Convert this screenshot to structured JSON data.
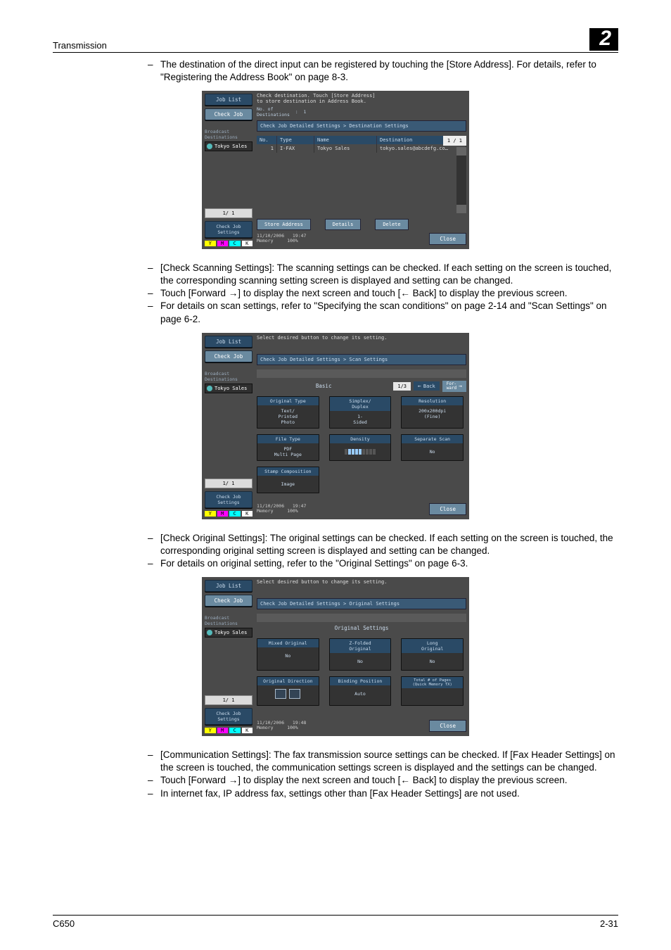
{
  "header": {
    "section": "Transmission",
    "chapter": "2"
  },
  "footer": {
    "left": "C650",
    "right": "2-31"
  },
  "para1": "The destination of the direct input can be registered by touching the [Store Address]. For details, refer to \"Registering the Address Book\" on page 8-3.",
  "para2a": "[Check Scanning Settings]: The scanning settings can be checked. If each setting on the screen is touched, the corresponding scanning setting screen is displayed and setting can be changed.",
  "para2b": "Touch [Forward →] to display the next screen and touch [← Back] to display the previous screen.",
  "para2c": "For details on scan settings, refer to \"Specifying the scan conditions\" on page 2-14 and \"Scan Settings\" on page 6-2.",
  "para3a": "[Check Original Settings]: The original settings can be checked. If each setting on the screen is touched, the corresponding original setting screen is displayed and setting can be changed.",
  "para3b": "For details on original setting, refer to the \"Original Settings\" on page 6-3.",
  "para4a": "[Communication Settings]: The fax transmission source settings can be checked. If [Fax Header Settings] on the screen is touched, the communication settings screen is displayed and the settings can be changed.",
  "para4b": "Touch [Forward →] to display the next screen and touch [← Back] to display the previous screen.",
  "para4c": "In internet fax, IP address fax, settings other than [Fax Header Settings] are not used.",
  "common": {
    "job_list": "Job List",
    "check_job": "Check Job",
    "broadcast": "Broadcast\nDestinations",
    "tokyo": "Tokyo Sales",
    "counter": "1/   1",
    "check_settings": "Check Job\nSettings",
    "close": "Close",
    "memory": "Memory",
    "mem_pct": "100%"
  },
  "s1": {
    "msg": "Check destination. Touch [Store Address]\nto store destination in Address Book.",
    "numdest_label": "No. of\nDestinations",
    "numdest_val": "1",
    "breadcrumb": "Check Job Detailed Settings > Destination Settings",
    "th": {
      "no": "No.",
      "type": "Type",
      "name": "Name",
      "dest": "Destination"
    },
    "row": {
      "no": "1",
      "type": "I-FAX",
      "name": "Tokyo Sales",
      "dest": "tokyo.sales@abcdefg.co…"
    },
    "page": "1 / 1",
    "store": "Store Address",
    "details": "Details",
    "delete": "Delete",
    "date": "11/10/2006",
    "time": "19:47"
  },
  "s2": {
    "msg": "Select desired button to change its setting.",
    "breadcrumb": "Check Job Detailed Settings > Scan Settings",
    "basic": "Basic",
    "page": "1/3",
    "back": "Back",
    "forward": "For-\nward",
    "tiles": {
      "original_type": {
        "h": "Original Type",
        "b": "Text/\nPrinted\nPhoto"
      },
      "duplex": {
        "h": "Simplex/\nDuplex",
        "b": "1-\nSided"
      },
      "resolution": {
        "h": "Resolution",
        "b": "200x200dpi\n(Fine)"
      },
      "file_type": {
        "h": "File Type",
        "b": "PDF\nMulti Page"
      },
      "density": {
        "h": "Density"
      },
      "separate": {
        "h": "Separate Scan",
        "b": "No"
      },
      "stamp": {
        "h": "Stamp Composition",
        "b": "Image"
      }
    },
    "date": "11/10/2006",
    "time": "19:47"
  },
  "s3": {
    "msg": "Select desired button to change its setting.",
    "breadcrumb": "Check Job Detailed Settings > Original Settings",
    "title": "Original Settings",
    "tiles": {
      "mixed": {
        "h": "Mixed Original",
        "b": "No"
      },
      "zfold": {
        "h": "Z-Folded\nOriginal",
        "b": "No"
      },
      "long": {
        "h": "Long\nOriginal",
        "b": "No"
      },
      "dir": {
        "h": "Original Direction"
      },
      "bind": {
        "h": "Binding Position",
        "b": "Auto"
      },
      "total": {
        "h": "Total # of Pages\n(Quick Memory TX)"
      }
    },
    "date": "11/10/2006",
    "time": "19:48"
  }
}
